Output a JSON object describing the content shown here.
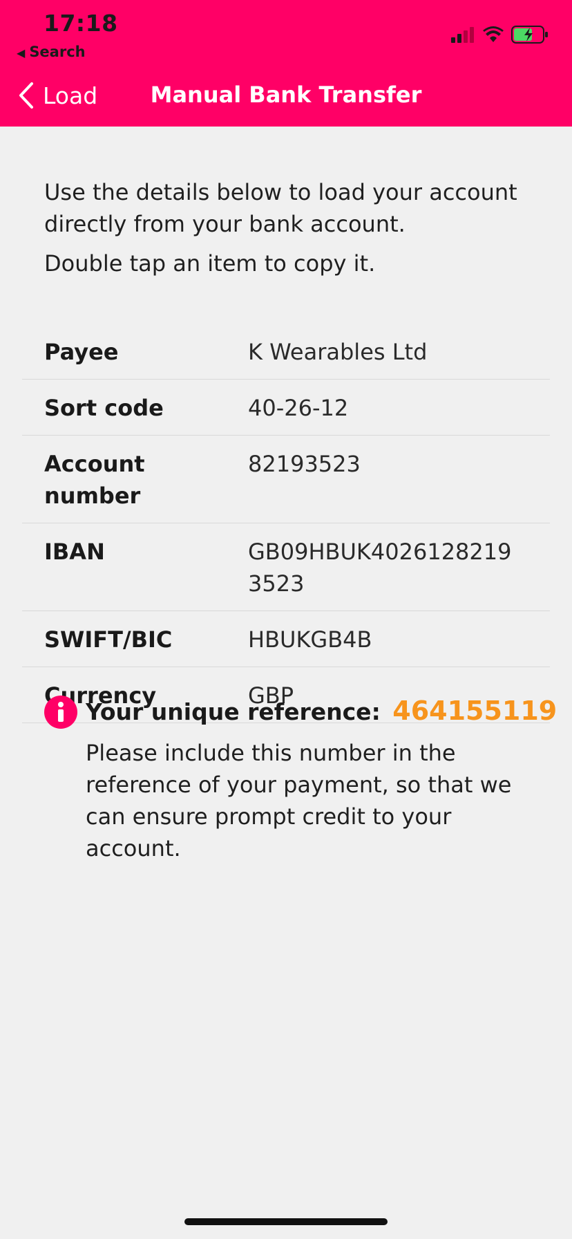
{
  "status_bar": {
    "time": "17:18",
    "back_app": "Search"
  },
  "nav": {
    "back_label": "Load",
    "title": "Manual Bank Transfer"
  },
  "intro": {
    "text": "Use the details below to load your account directly from your bank account.",
    "hint": "Double tap an item to copy it."
  },
  "details": [
    {
      "label": "Payee",
      "value": "K Wearables Ltd"
    },
    {
      "label": "Sort code",
      "value": "40-26-12"
    },
    {
      "label": "Account number",
      "value": "82193523"
    },
    {
      "label": "IBAN",
      "value": "GB09HBUK40261282193523"
    },
    {
      "label": "SWIFT/BIC",
      "value": "HBUKGB4B"
    },
    {
      "label": "Currency",
      "value": "GBP"
    }
  ],
  "reference": {
    "label": "Your unique reference:",
    "number": "464155119",
    "note": "Please include this number in the reference of your payment, so that we can ensure prompt credit to your account."
  },
  "colors": {
    "brand": "#ff0066",
    "accent": "#f7941d",
    "background": "#f0f0f0"
  },
  "icons": [
    "signal-icon",
    "wifi-icon",
    "battery-charging-icon",
    "chevron-left-icon",
    "info-icon"
  ]
}
